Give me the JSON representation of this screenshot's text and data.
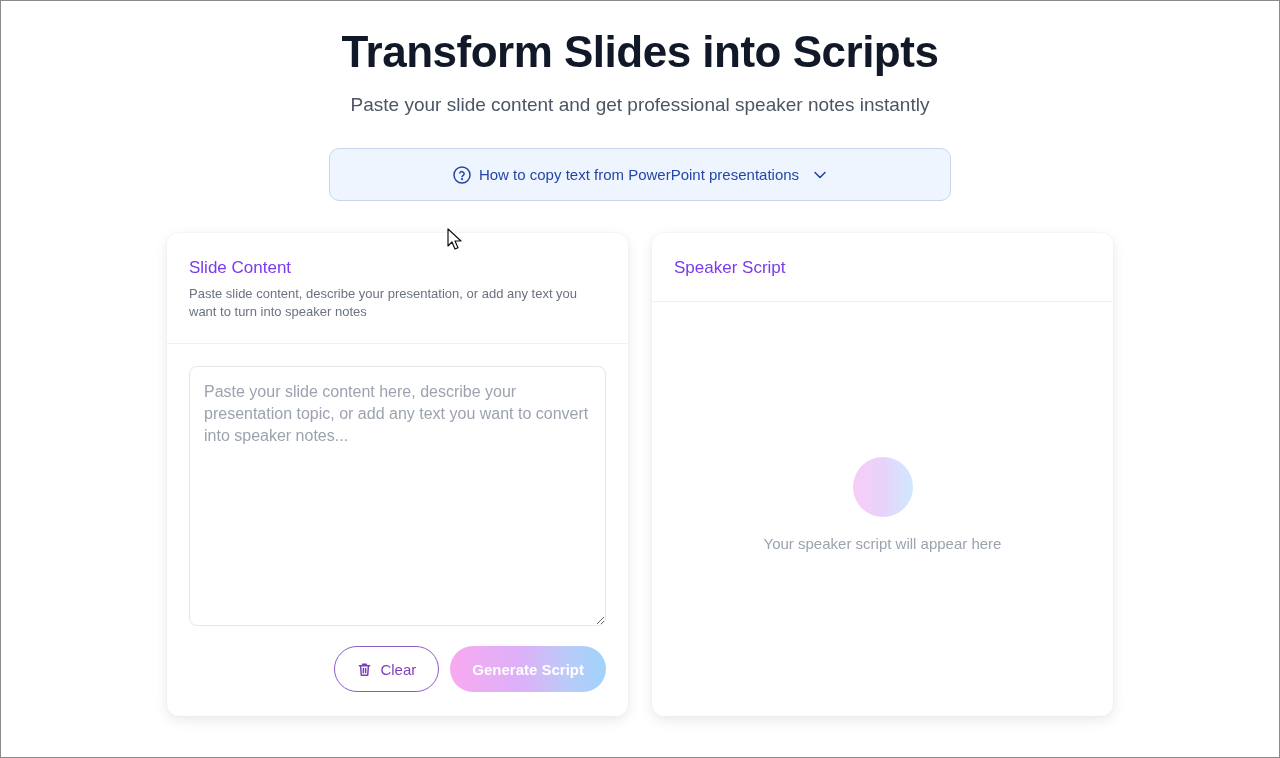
{
  "header": {
    "title": "Transform Slides into Scripts",
    "subtitle": "Paste your slide content and get professional speaker notes instantly"
  },
  "help_toggle": {
    "label": "How to copy text from PowerPoint presentations",
    "expanded": false
  },
  "input_panel": {
    "title": "Slide Content",
    "description": "Paste slide content, describe your presentation, or add any text you want to turn into speaker notes",
    "textarea": {
      "placeholder": "Paste your slide content here, describe your presentation topic, or add any text you want to convert into speaker notes..."
    },
    "buttons": [
      {
        "label": "Clear",
        "kind": "secondary",
        "disabled": false
      },
      {
        "label": "Generate Script",
        "kind": "primary",
        "disabled": true
      }
    ]
  },
  "output_panel": {
    "title": "Speaker Script",
    "empty_message": "Your speaker script will appear here"
  }
}
